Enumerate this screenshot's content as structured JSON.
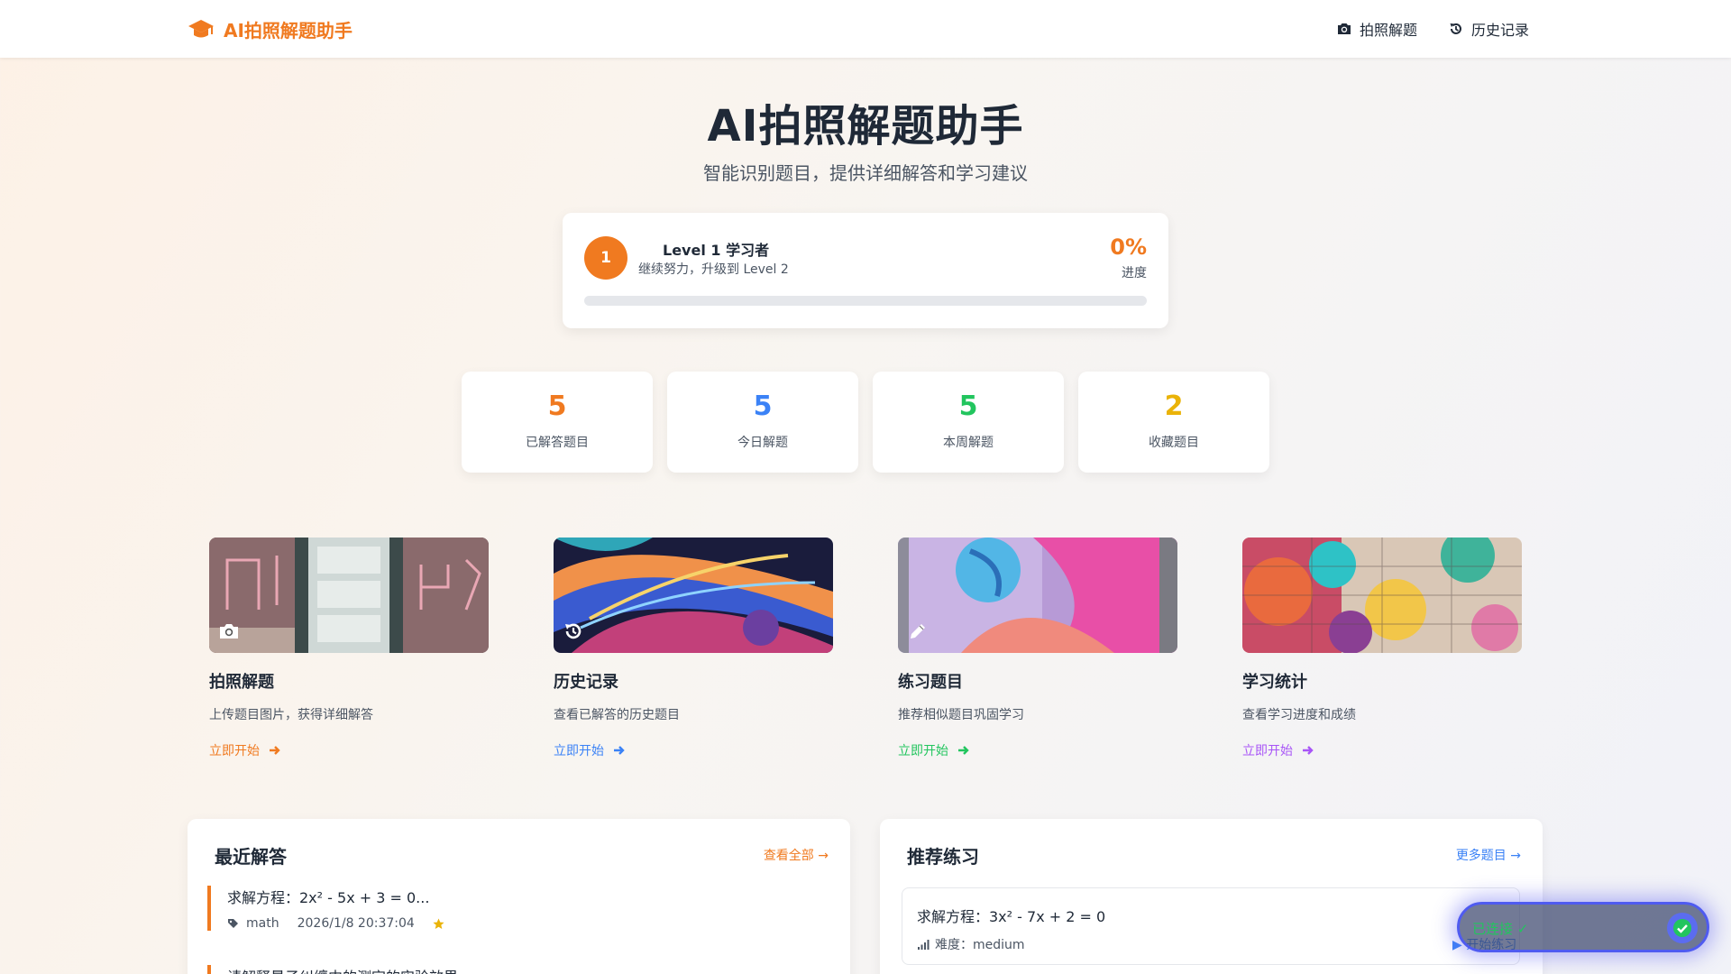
{
  "nav": {
    "brand": "AI拍照解题助手",
    "links": [
      {
        "label": "拍照解题",
        "icon": "camera-icon"
      },
      {
        "label": "历史记录",
        "icon": "history-icon"
      }
    ]
  },
  "hero": {
    "title": "AI拍照解题助手",
    "subtitle": "智能识别题目，提供详细解答和学习建议"
  },
  "level": {
    "badge": "1",
    "name": "Level 1 学习者",
    "hint": "继续努力，升级到 Level 2",
    "percent_text": "0%",
    "percent_label": "进度",
    "progress": 0
  },
  "stats": [
    {
      "value": "5",
      "label": "已解答题目",
      "color": "#f07a20"
    },
    {
      "value": "5",
      "label": "今日解题",
      "color": "#3b82f6"
    },
    {
      "value": "5",
      "label": "本周解题",
      "color": "#22c55e"
    },
    {
      "value": "2",
      "label": "收藏题目",
      "color": "#eab308"
    }
  ],
  "features": [
    {
      "title": "拍照解题",
      "desc": "上传题目图片，获得详细解答",
      "cta": "立即开始",
      "color": "#f07a20",
      "icon": "camera-icon"
    },
    {
      "title": "历史记录",
      "desc": "查看已解答的历史题目",
      "cta": "立即开始",
      "color": "#3b82f6",
      "icon": "history-icon"
    },
    {
      "title": "练习题目",
      "desc": "推荐相似题目巩固学习",
      "cta": "立即开始",
      "color": "#22c55e",
      "icon": "pencil-icon"
    },
    {
      "title": "学习统计",
      "desc": "查看学习进度和成绩",
      "cta": "立即开始",
      "color": "#a855f7",
      "icon": "chart-icon"
    }
  ],
  "recent": {
    "title": "最近解答",
    "view_all": "查看全部 →",
    "items": [
      {
        "question": "求解方程：2x² - 5x + 3 = 0...",
        "subject": "math",
        "time": "2026/1/8 20:37:04"
      },
      {
        "question": "请解释量子纠缠中的测定的实验效果"
      }
    ]
  },
  "recommend": {
    "title": "推荐练习",
    "more": "更多题目 →",
    "item": {
      "question": "求解方程：3x² - 7x + 2 = 0",
      "difficulty": "难度：medium",
      "start": "▶ 开始练习"
    }
  },
  "toast": {
    "text": "已连接 ✓"
  }
}
